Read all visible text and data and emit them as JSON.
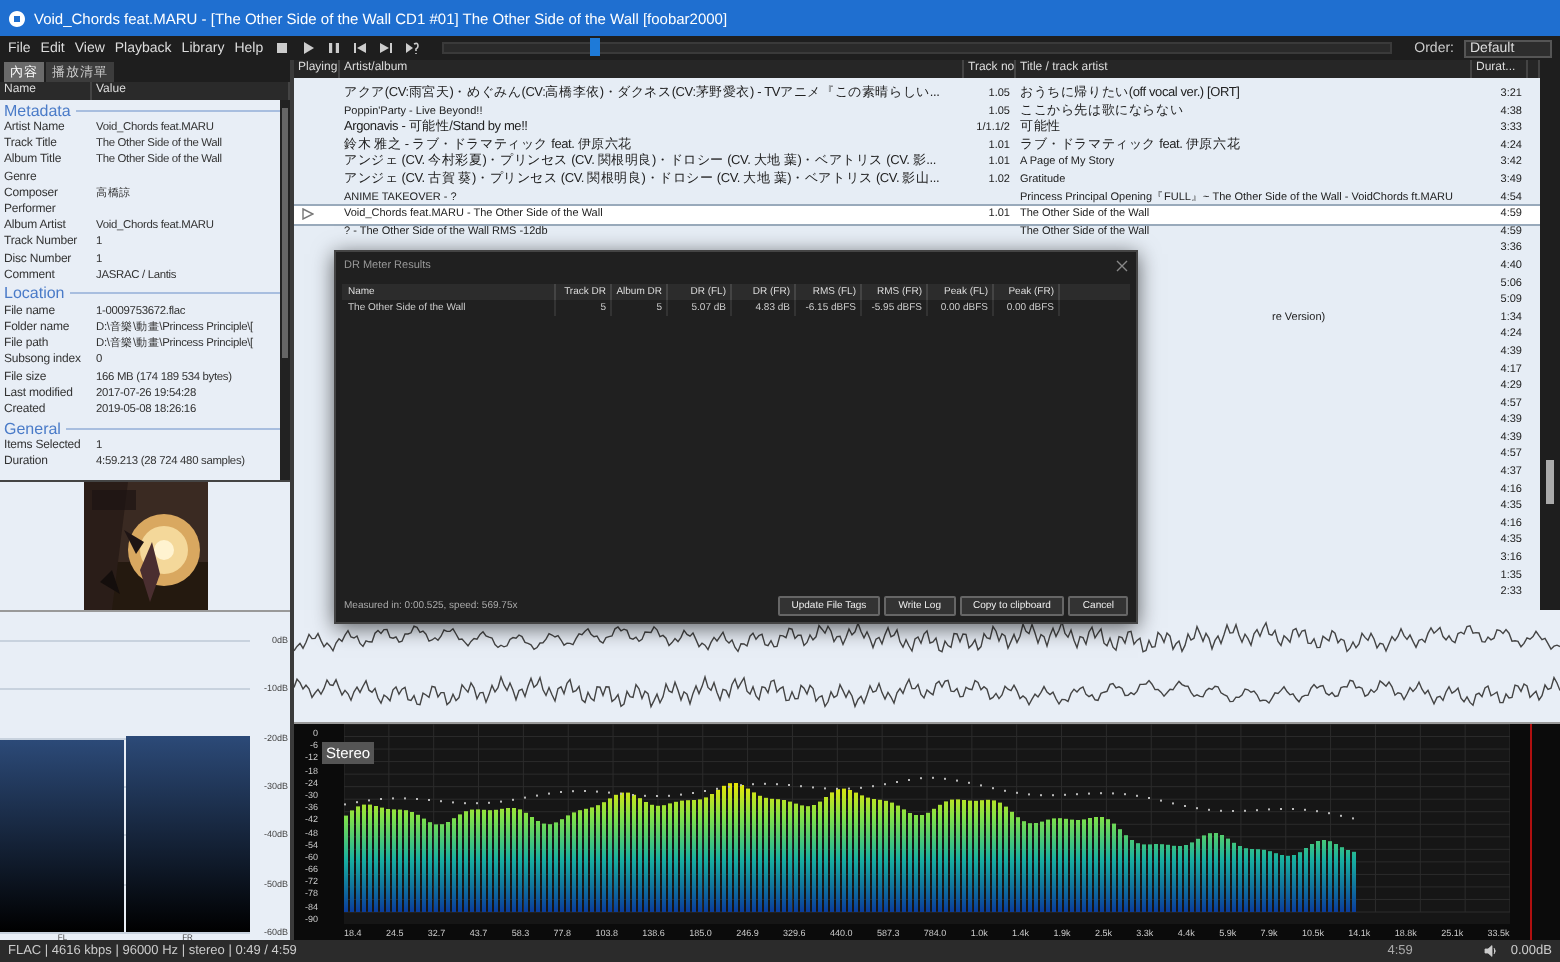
{
  "window": {
    "title": "Void_Chords feat.MARU - [The Other Side of the Wall CD1 #01] The Other Side of the Wall  [foobar2000]"
  },
  "menu": [
    "File",
    "Edit",
    "View",
    "Playback",
    "Library",
    "Help"
  ],
  "seek": {
    "level": 0.16
  },
  "order": {
    "label": "Order:",
    "value": "Default"
  },
  "left_tabs": [
    {
      "label": "內容",
      "selected": true
    },
    {
      "label": "播放清單",
      "selected": false
    }
  ],
  "properties": {
    "columns": [
      "Name",
      "Value"
    ],
    "rows": [
      {
        "kind": "group",
        "name": "Metadata"
      },
      {
        "kind": "field",
        "name": "Artist Name",
        "value": "Void_Chords feat.MARU"
      },
      {
        "kind": "field",
        "name": "Track Title",
        "value": "The Other Side of the Wall"
      },
      {
        "kind": "field",
        "name": "Album Title",
        "value": "The Other Side of the Wall"
      },
      {
        "kind": "field",
        "name": "Genre"
      },
      {
        "kind": "field",
        "name": "Composer",
        "value": "高橋諒"
      },
      {
        "kind": "field",
        "name": "Performer"
      },
      {
        "kind": "field",
        "name": "Album Artist",
        "value": "Void_Chords feat.MARU"
      },
      {
        "kind": "field",
        "name": "Track Number",
        "value": "1"
      },
      {
        "kind": "field",
        "name": "Disc Number",
        "value": "1"
      },
      {
        "kind": "field",
        "name": "Comment",
        "value": "JASRAC / Lantis"
      },
      {
        "kind": "group",
        "name": "Location"
      },
      {
        "kind": "field",
        "name": "File name",
        "value": "1-0009753672.flac"
      },
      {
        "kind": "field",
        "name": "Folder name",
        "value": "D:\\音樂\\動畫\\Princess Principle\\["
      },
      {
        "kind": "field",
        "name": "File path",
        "value": "D:\\音樂\\動畫\\Princess Principle\\["
      },
      {
        "kind": "field",
        "name": "Subsong index",
        "value": "0"
      },
      {
        "kind": "field",
        "name": "File size",
        "value": "166 MB (174 189 534 bytes)"
      },
      {
        "kind": "field",
        "name": "Last modified",
        "value": "2017-07-26 19:54:28"
      },
      {
        "kind": "field",
        "name": "Created",
        "value": "2019-05-08 18:26:16"
      },
      {
        "kind": "group",
        "name": "General"
      },
      {
        "kind": "field",
        "name": "Items Selected",
        "value": "1"
      },
      {
        "kind": "field",
        "name": "Duration",
        "value": "4:59.213 (28 724 480 samples)"
      }
    ]
  },
  "vu_meter": {
    "scale": [
      "0dB",
      "-10dB",
      "-20dB",
      "-30dB",
      "-40dB",
      "-50dB",
      "-60dB"
    ],
    "channels": [
      {
        "name": "FL",
        "level": 0.66
      },
      {
        "name": "FR",
        "level": 0.67
      }
    ]
  },
  "playlist": {
    "columns": [
      "Playing",
      "Artist/album",
      "Track no",
      "Title / track artist",
      "Durat..."
    ],
    "rows": [
      {
        "playing": false,
        "selected": false,
        "artist": "アクア(CV:雨宮天)・めぐみん(CV:高橋李依)・ダクネス(CV:茅野愛衣) - TVアニメ『この素晴らしい...",
        "track_no": "1.05",
        "title": "おうちに帰りたい(off vocal ver.) [ORT]",
        "duration": "3:21"
      },
      {
        "playing": false,
        "selected": false,
        "artist": "Poppin'Party - Live Beyond!!",
        "track_no": "1.05",
        "title": "ここから先は歌にならない",
        "duration": "4:38"
      },
      {
        "playing": false,
        "selected": false,
        "artist": "Argonavis - 可能性/Stand by me!!",
        "track_no": "1/1.1/2",
        "title": "可能性",
        "duration": "3:33"
      },
      {
        "playing": false,
        "selected": false,
        "artist": "鈴木 雅之 - ラブ・ドラマティック feat. 伊原六花",
        "track_no": "1.01",
        "title": "ラブ・ドラマティック feat. 伊原六花",
        "duration": "4:24"
      },
      {
        "playing": false,
        "selected": false,
        "artist": "アンジェ (CV. 今村彩夏)・プリンセス (CV. 関根明良)・ドロシー (CV. 大地 葉)・ベアトリス (CV. 影...",
        "track_no": "1.01",
        "title": "A Page of My Story",
        "duration": "3:42"
      },
      {
        "playing": false,
        "selected": false,
        "artist": "アンジェ (CV. 古賀 葵)・プリンセス (CV. 関根明良)・ドロシー (CV. 大地 葉)・ベアトリス (CV. 影山...",
        "track_no": "1.02",
        "title": "Gratitude",
        "duration": "3:49"
      },
      {
        "playing": false,
        "selected": false,
        "artist": "ANIME TAKEOVER - ?",
        "title": "Princess Principal Opening『FULL』~ The Other Side of the Wall - VoidChords ft.MARU",
        "duration": "4:54"
      },
      {
        "playing": true,
        "selected": true,
        "artist": "Void_Chords feat.MARU - The Other Side of the Wall",
        "track_no": "1.01",
        "title": "The Other Side of the Wall",
        "duration": "4:59"
      },
      {
        "playing": false,
        "selected": false,
        "artist": "? - The Other Side of the Wall RMS -12db",
        "title": "The Other Side of the Wall",
        "duration": "4:59"
      },
      {
        "playing": false,
        "selected": false,
        "duration": "3:36"
      },
      {
        "playing": false,
        "selected": false,
        "duration": "4:40"
      },
      {
        "playing": false,
        "selected": false,
        "duration": "5:06"
      },
      {
        "playing": false,
        "selected": false,
        "duration": "5:09"
      },
      {
        "playing": false,
        "selected": false,
        "title_tail": "re Version)",
        "duration": "1:34"
      },
      {
        "playing": false,
        "selected": false,
        "duration": "4:24"
      },
      {
        "playing": false,
        "selected": false,
        "duration": "4:39"
      },
      {
        "playing": false,
        "selected": false,
        "duration": "4:17"
      },
      {
        "playing": false,
        "selected": false,
        "duration": "4:29"
      },
      {
        "playing": false,
        "selected": false,
        "duration": "4:57"
      },
      {
        "playing": false,
        "selected": false,
        "duration": "4:39"
      },
      {
        "playing": false,
        "selected": false,
        "duration": "4:39"
      },
      {
        "playing": false,
        "selected": false,
        "duration": "4:57"
      },
      {
        "playing": false,
        "selected": false,
        "duration": "4:37"
      },
      {
        "playing": false,
        "selected": false,
        "duration": "4:16"
      },
      {
        "playing": false,
        "selected": false,
        "duration": "4:35"
      },
      {
        "playing": false,
        "selected": false,
        "duration": "4:16"
      },
      {
        "playing": false,
        "selected": false,
        "duration": "4:35"
      },
      {
        "playing": false,
        "selected": false,
        "duration": "3:16"
      },
      {
        "playing": false,
        "selected": false,
        "duration": "1:35"
      },
      {
        "playing": false,
        "selected": false,
        "duration": "2:33"
      }
    ]
  },
  "dr_dialog": {
    "title": "DR Meter Results",
    "columns": [
      "Name",
      "Track DR",
      "Album DR",
      "DR (FL)",
      "DR (FR)",
      "RMS (FL)",
      "RMS (FR)",
      "Peak (FL)",
      "Peak (FR)"
    ],
    "rows": [
      [
        "The Other Side of the Wall",
        "5",
        "5",
        "5.07 dB",
        "4.83 dB",
        "-6.15 dBFS",
        "-5.95 dBFS",
        "0.00 dBFS",
        "0.00 dBFS"
      ]
    ],
    "measured": "Measured in: 0:00.525, speed: 569.75x",
    "buttons": [
      "Update File Tags",
      "Write Log",
      "Copy to clipboard",
      "Cancel"
    ]
  },
  "spectrum": {
    "label": "Stereo",
    "y_labels": [
      "0",
      "-6",
      "-12",
      "-18",
      "-24",
      "-30",
      "-36",
      "-42",
      "-48",
      "-54",
      "-60",
      "-66",
      "-72",
      "-78",
      "-84",
      "-90"
    ],
    "x_labels": [
      "18.4",
      "24.5",
      "32.7",
      "43.7",
      "58.3",
      "77.8",
      "103.8",
      "138.6",
      "185.0",
      "246.9",
      "329.6",
      "440.0",
      "587.3",
      "784.0",
      "1.0k",
      "1.4k",
      "1.9k",
      "2.5k",
      "3.3k",
      "4.4k",
      "5.9k",
      "7.9k",
      "10.5k",
      "14.1k",
      "18.8k",
      "25.1k",
      "33.5k"
    ]
  },
  "status_bar": {
    "info": "FLAC | 4616 kbps | 96000 Hz | stereo | 0:49 / 4:59",
    "time": "4:59",
    "volume": "0.00dB"
  }
}
